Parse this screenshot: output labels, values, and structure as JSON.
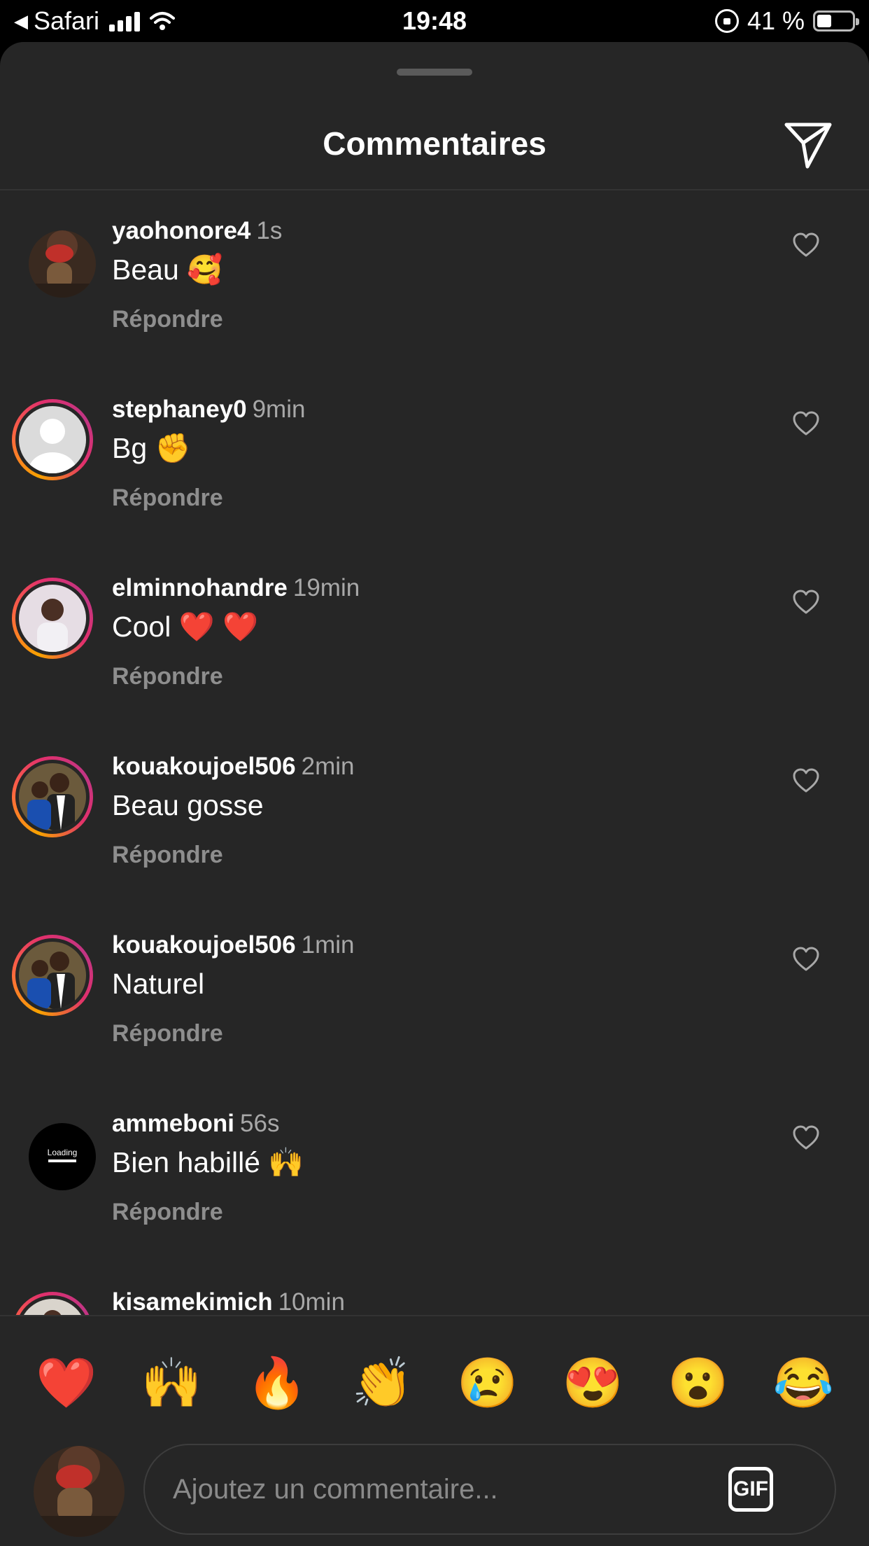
{
  "status_bar": {
    "back_app": "Safari",
    "time": "19:48",
    "battery_percent": "41 %",
    "battery_level": 0.41
  },
  "header": {
    "title": "Commentaires"
  },
  "comments": [
    {
      "username": "yaohonore4",
      "time": "1s",
      "text": "Beau 🥰",
      "reply": "Répondre",
      "avatar": "photo-red-hat",
      "story_ring": false
    },
    {
      "username": "stephaney0",
      "time": "9min",
      "text": "Bg ✊",
      "reply": "Répondre",
      "avatar": "default-user",
      "story_ring": true
    },
    {
      "username": "elminnohandre",
      "time": "19min",
      "text": "Cool ❤️ ❤️",
      "reply": "Répondre",
      "avatar": "photo-man-white-shirt",
      "story_ring": true
    },
    {
      "username": "kouakoujoel506",
      "time": "2min",
      "text": "Beau gosse",
      "reply": "Répondre",
      "avatar": "photo-man-suit",
      "story_ring": true
    },
    {
      "username": "kouakoujoel506",
      "time": "1min",
      "text": "Naturel",
      "reply": "Répondre",
      "avatar": "photo-man-suit",
      "story_ring": true
    },
    {
      "username": "ammeboni",
      "time": "56s",
      "text": "Bien habillé 🙌",
      "reply": "Répondre",
      "avatar": "loading-logo",
      "avatar_text": "Loading",
      "story_ring": false
    },
    {
      "username": "kisamekimich",
      "time": "10min",
      "text": "",
      "reply": "",
      "avatar": "photo-man",
      "story_ring": true
    }
  ],
  "reactions": [
    "❤️",
    "🙌",
    "🔥",
    "👏",
    "😢",
    "😍",
    "😮",
    "😂"
  ],
  "composer": {
    "placeholder": "Ajoutez un commentaire...",
    "gif_label": "GIF"
  },
  "colors": {
    "sheet_background": "#262626",
    "status_bar_background": "#000000",
    "secondary_text": "#a8a8a8",
    "reply_text": "#8e8e8e"
  }
}
